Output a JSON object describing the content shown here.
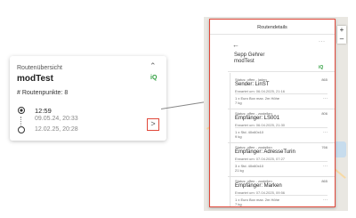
{
  "card": {
    "overview_label": "Routenübersicht",
    "collapse_icon": "chevron-up-icon",
    "title": "modTest",
    "badge": "iQ",
    "points": "# Routenpunkte: 8",
    "duration": "12:59",
    "start": "09.05.24, 20:33",
    "end": "12.02.25, 20:28",
    "open_icon": "chevron-right-icon"
  },
  "panel": {
    "title": "Routendetails",
    "back_icon": "arrow-left-icon",
    "more": "···",
    "driver": "Sepp Gehrer",
    "route": "modTest",
    "badge": "iQ",
    "stops": [
      {
        "status": "Status: offen - laden",
        "dist": "865",
        "name": "Sender: LinST",
        "expected": "Erwartet um: 06.04.2025, 21:16",
        "item": "1 x Euro Box max. 2m Höhe",
        "weight": "7 kg"
      },
      {
        "status": "Status: offen - zustellen",
        "dist": "806",
        "name": "Empfänger: LS001",
        "expected": "Erwartet um: 06.04.2025, 21:30",
        "item": "1 x Std. 40x60x10",
        "weight": "9 kg"
      },
      {
        "status": "Status: offen - zustellen",
        "dist": "766",
        "name": "Empfänger: AdresseTurin",
        "expected": "Erwartet um: 07.04.2025, 07:27",
        "item": "3 x Std. 40x60x10",
        "weight": "21 kg"
      },
      {
        "status": "Status: offen - zustellen",
        "dist": "865",
        "name": "Empfänger: Marken",
        "expected": "Erwartet um: 07.04.2025, 09:56",
        "item": "1 x Euro Box max. 2m Höhe",
        "weight": "7 kg"
      }
    ]
  },
  "map": {
    "zoom_in": "+",
    "zoom_out": "–"
  },
  "colors": {
    "highlight": "#e0483a",
    "badge_green": "#2e9e3e"
  }
}
